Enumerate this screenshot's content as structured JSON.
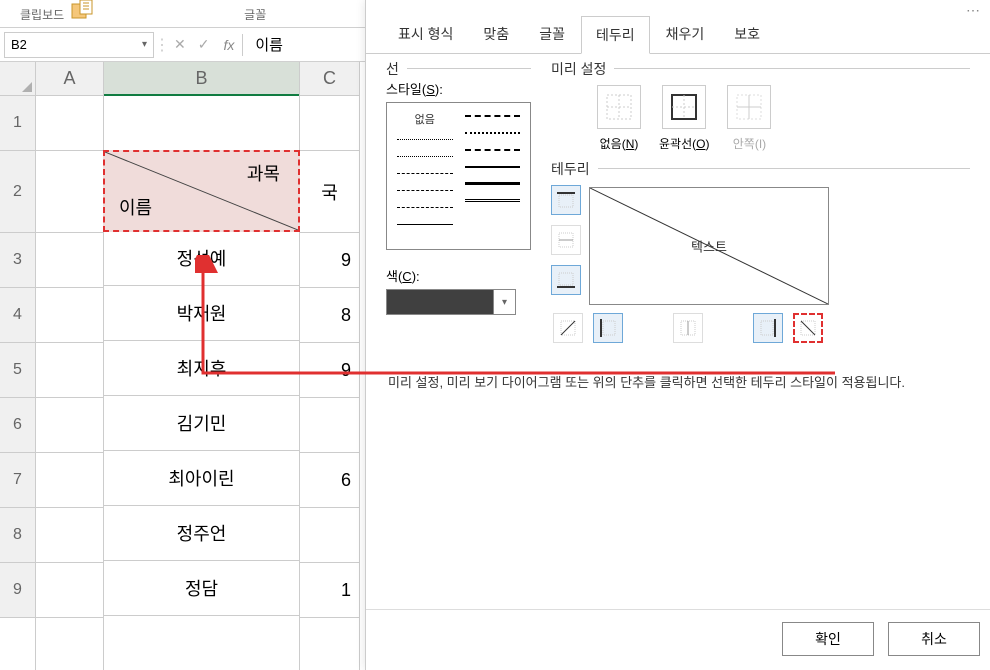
{
  "ribbon": {
    "group1": "클립보드",
    "group2": "글꼴"
  },
  "namebox": {
    "value": "B2"
  },
  "formula": {
    "value": "이름"
  },
  "columns": {
    "a": "A",
    "b": "B",
    "c": "C"
  },
  "rows": [
    "1",
    "2",
    "3",
    "4",
    "5",
    "6",
    "7",
    "8",
    "9"
  ],
  "b2": {
    "top": "과목",
    "bottom": "이름"
  },
  "names": [
    "정선예",
    "박재원",
    "최지후",
    "김기민",
    "최아이린",
    "정주언",
    "정담"
  ],
  "colC": {
    "header": "국",
    "vals": [
      "9",
      "8",
      "9",
      "",
      "6",
      "",
      "1"
    ]
  },
  "dialog": {
    "tabs": [
      "표시 형식",
      "맞춤",
      "글꼴",
      "테두리",
      "채우기",
      "보호"
    ],
    "line_group": "선",
    "style_label_prefix": "스타일(",
    "style_label_key": "S",
    "style_label_suffix": "):",
    "style_none": "없음",
    "color_label_prefix": "색(",
    "color_label_key": "C",
    "color_label_suffix": "):",
    "preset_group": "미리 설정",
    "preset_none_prefix": "없음(",
    "preset_none_key": "N",
    "preset_none_suffix": ")",
    "preset_outline_prefix": "윤곽선(",
    "preset_outline_key": "O",
    "preset_outline_suffix": ")",
    "preset_inside_prefix": "안쪽(",
    "preset_inside_key": "I",
    "preset_inside_suffix": ")",
    "border_group": "테두리",
    "preview_text": "텍스트",
    "note": "미리 설정, 미리 보기 다이어그램 또는 위의 단추를 클릭하면 선택한 테두리 스타일이 적용됩니다.",
    "ok": "확인",
    "cancel": "취소"
  }
}
